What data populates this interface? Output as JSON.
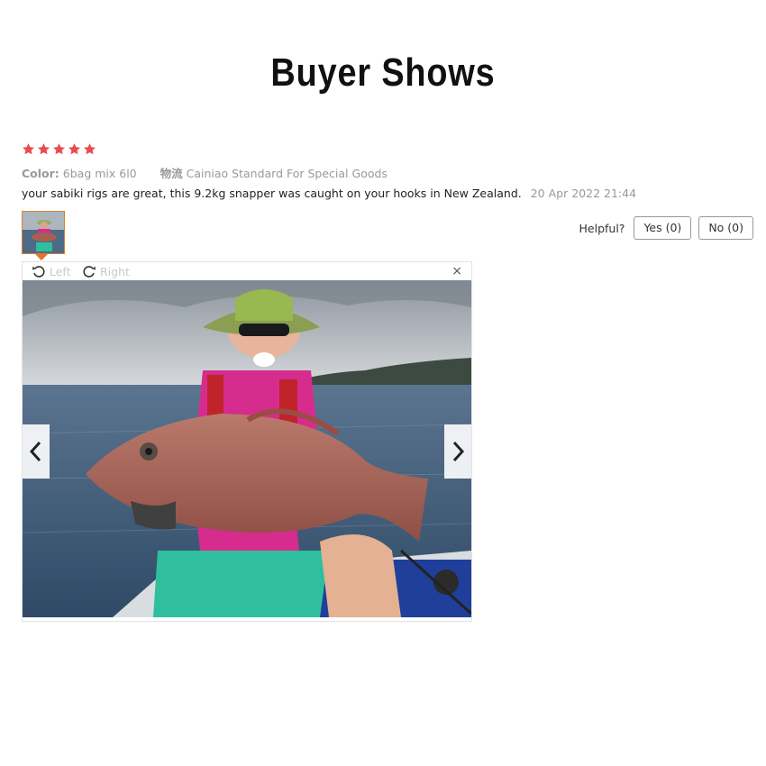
{
  "page": {
    "title": "Buyer Shows"
  },
  "review": {
    "rating": 5,
    "star_color": "#e84d4d",
    "color_label": "Color:",
    "color_value": "6bag mix 6l0",
    "logistics_label": "物流",
    "logistics_value": "Cainiao Standard For Special Goods",
    "text": "your sabiki rigs are great, this 9.2kg snapper was caught on your hooks in New Zealand.",
    "date": "20 Apr 2022 21:44"
  },
  "helpful": {
    "label": "Helpful?",
    "yes": "Yes (0)",
    "no": "No (0)"
  },
  "viewer": {
    "rotate_left": "Left",
    "rotate_right": "Right",
    "close_icon": "×"
  },
  "icons": {
    "star": "star-icon",
    "rotate_left": "rotate-left-icon",
    "rotate_right": "rotate-right-icon",
    "close": "close-icon",
    "prev": "chevron-left-icon",
    "next": "chevron-right-icon"
  }
}
